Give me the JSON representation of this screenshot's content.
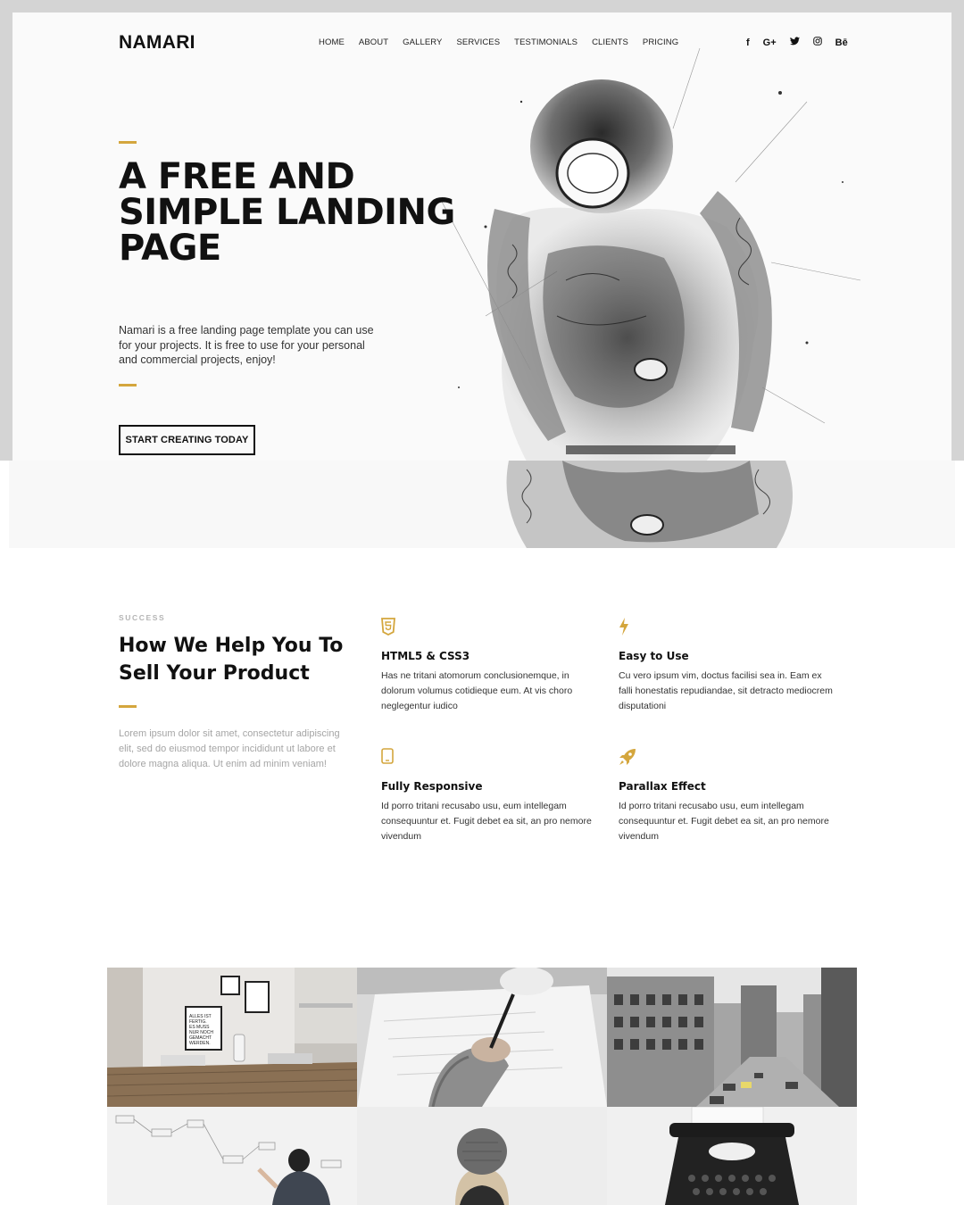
{
  "brand": {
    "logo": "NAMARI",
    "accent_color": "#d4a63d"
  },
  "nav": {
    "items": [
      "HOME",
      "ABOUT",
      "GALLERY",
      "SERVICES",
      "TESTIMONIALS",
      "CLIENTS",
      "PRICING"
    ]
  },
  "social": {
    "facebook": "f",
    "google_plus": "G+",
    "twitter": "twitter-icon",
    "instagram": "instagram-icon",
    "behance": "Bē"
  },
  "hero": {
    "title": "A FREE AND SIMPLE LANDING PAGE",
    "description": "Namari is a free landing page template you can use for your projects. It is free to use for your personal and commercial projects, enjoy!",
    "cta_label": "START CREATING TODAY",
    "image_icon": "tattooed-figure-sketch-illustration"
  },
  "services": {
    "kicker": "SUCCESS",
    "title": "How We Help You To Sell Your Product",
    "description": "Lorem ipsum dolor sit amet, consectetur adipiscing elit, sed do eiusmod tempor incididunt ut labore et dolore magna aliqua. Ut enim ad minim veniam!",
    "features": [
      {
        "icon": "html5-icon",
        "title": "HTML5 & CSS3",
        "text": "Has ne tritani atomorum conclusionemque, in dolorum volumus cotidieque eum. At vis choro neglegentur iudico"
      },
      {
        "icon": "bolt-icon",
        "title": "Easy to Use",
        "text": "Cu vero ipsum vim, doctus facilisi sea in. Eam ex falli honestatis repudiandae, sit detracto mediocrem disputationi"
      },
      {
        "icon": "tablet-icon",
        "title": "Fully Responsive",
        "text": "Id porro tritani recusabo usu, eum intellegam consequuntur et. Fugit debet ea sit, an pro nemore vivendum"
      },
      {
        "icon": "rocket-icon",
        "title": "Parallax Effect",
        "text": "Id porro tritani recusabo usu, eum intellegam consequuntur et. Fugit debet ea sit, an pro nemore vivendum"
      }
    ]
  },
  "gallery": {
    "tiles": [
      "office-desk-photo",
      "hand-writing-photo",
      "city-street-photo",
      "whiteboard-photo",
      "beanie-person-photo",
      "typewriter-photo"
    ],
    "poster_text": "ALLES IST FERTIG. ES MUSS NUR NOCH GEMACHT WERDEN."
  }
}
